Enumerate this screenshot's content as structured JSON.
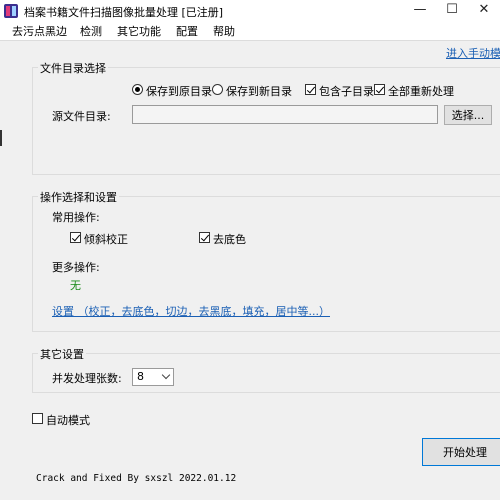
{
  "window": {
    "title": "档案书籍文件扫描图像批量处理 [已注册]",
    "minimize": "—",
    "maximize": "☐",
    "close": "✕"
  },
  "menu": [
    "去污点黑边",
    "检测",
    "其它功能",
    "配置",
    "帮助"
  ],
  "manual_link": "进入手动模式",
  "dir_group": {
    "title": "文件目录选择",
    "radio_original": "保存到原目录",
    "radio_new": "保存到新目录",
    "check_subdirs": "包含子目录",
    "check_reprocess": "全部重新处理",
    "source_label": "源文件目录:",
    "source_value": "",
    "browse_button": "选择..."
  },
  "ops_group": {
    "title": "操作选择和设置",
    "common_label": "常用操作:",
    "deskew": "倾斜校正",
    "remove_bg": "去底色",
    "more_label": "更多操作:",
    "more_value": "无",
    "settings_link": "设置 （校正，去底色，切边，去黑底，填充，居中等...）"
  },
  "other_group": {
    "title": "其它设置",
    "concurrency_label": "并发处理张数:",
    "concurrency_value": "8"
  },
  "auto_mode": "自动模式",
  "start_button": "开始处理",
  "footer": "Crack and Fixed By sxszl  2022.01.12",
  "colors": {
    "link": "#1a5fb4",
    "green": "#1a8a1a",
    "panel": "#f0f0f0"
  }
}
